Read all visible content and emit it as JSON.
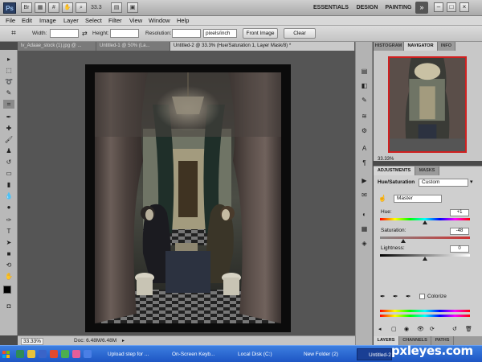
{
  "app": {
    "logo": "Ps",
    "zoom": "33.3",
    "workspaces": [
      "ESSENTIALS",
      "DESIGN",
      "PAINTING"
    ],
    "more": "»",
    "window_buttons": [
      "–",
      "□",
      "×"
    ]
  },
  "menu": [
    "File",
    "Edit",
    "Image",
    "Layer",
    "Select",
    "Filter",
    "View",
    "Window",
    "Help"
  ],
  "options": {
    "width_label": "Width:",
    "height_label": "Height:",
    "resolution_label": "Resolution:",
    "unit": "pixels/inch",
    "front_image": "Front Image",
    "clear": "Clear"
  },
  "tabs": [
    "lv_Adaae_stock (1).jpg @ ...",
    "Untitled-1 @ 50% (La...",
    "Untitled-2 @ 33.3% (Hue/Saturation 1, Layer Mask/8) *"
  ],
  "status": {
    "zoom": "33.33%",
    "doc": "Doc: 6.48M/6.48M"
  },
  "navigator": {
    "tabs": [
      "HISTOGRAM",
      "NAVIGATOR",
      "INFO"
    ],
    "zoom": "33.33%"
  },
  "adjustments": {
    "tabs": [
      "ADJUSTMENTS",
      "MASKS"
    ],
    "title": "Hue/Saturation",
    "preset": "Custom",
    "channel": "Master",
    "hue_label": "Hue:",
    "hue_value": "+1",
    "saturation_label": "Saturation:",
    "saturation_value": "-48",
    "lightness_label": "Lightness:",
    "lightness_value": "0",
    "colorize": "Colorize"
  },
  "layers": {
    "tabs": [
      "LAYERS",
      "CHANNELS",
      "PATHS"
    ]
  },
  "taskbar": {
    "items": [
      "Upload step for ...",
      "On-Screen Keyb...",
      "Local Disk (C:)",
      "New Folder (2)",
      "Untitled-2"
    ],
    "watermark": "pxleyes.com"
  },
  "colors": {
    "taskbar": "#2a66d6",
    "nav_frame": "#d02020"
  }
}
